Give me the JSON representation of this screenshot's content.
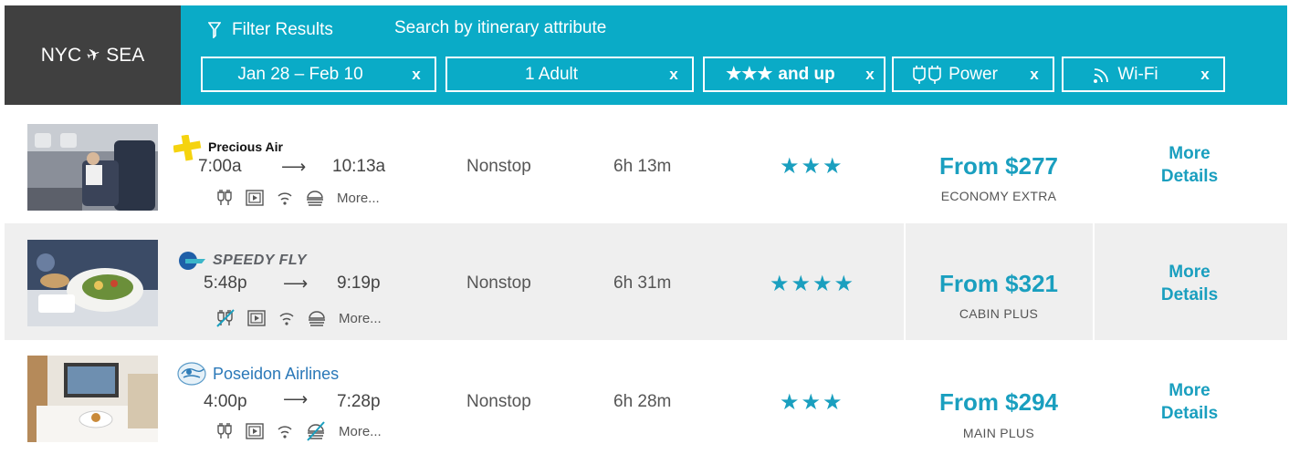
{
  "route": {
    "origin": "NYC",
    "destination": "SEA"
  },
  "filter": {
    "title": "Filter Results",
    "subtitle": "Search by itinerary attribute",
    "chips": [
      {
        "label": "Jan 28 – Feb 10",
        "close": "x"
      },
      {
        "label": "1 Adult",
        "close": "x"
      },
      {
        "stars": "★★★",
        "label": "and up",
        "close": "x"
      },
      {
        "label": "Power",
        "close": "x",
        "icon": "power-plug-icon"
      },
      {
        "label": "Wi-Fi",
        "close": "x",
        "icon": "wifi-icon"
      }
    ]
  },
  "flights": [
    {
      "airline": "Precious Air",
      "logo_icon": "precious-air-logo",
      "depart": "7:00a",
      "arrow": "⟶",
      "arrive": "10:13a",
      "amenities": [
        "power-icon",
        "entertainment-icon",
        "wifi-icon",
        "meal-icon"
      ],
      "more": "More...",
      "stops": "Nonstop",
      "duration": "6h 13m",
      "rating": "★★★",
      "price": "From $277",
      "fare": "ECONOMY EXTRA",
      "details": [
        "More",
        "Details"
      ]
    },
    {
      "airline": "SPEEDY FLY",
      "logo_icon": "speedy-fly-logo",
      "depart": "5:48p",
      "arrow": "⟶",
      "arrive": "9:19p",
      "amenities": [
        "power-unavailable-icon",
        "entertainment-icon",
        "wifi-icon",
        "meal-icon"
      ],
      "more": "More...",
      "stops": "Nonstop",
      "duration": "6h 31m",
      "rating": "★★★★",
      "price": "From $321",
      "fare": "CABIN PLUS",
      "details": [
        "More",
        "Details"
      ]
    },
    {
      "airline": "Poseidon Airlines",
      "logo_icon": "poseidon-airlines-logo",
      "depart": "4:00p",
      "arrow": "⟶",
      "arrive": "7:28p",
      "amenities": [
        "power-icon",
        "entertainment-icon",
        "wifi-icon",
        "meal-unavailable-icon"
      ],
      "more": "More...",
      "stops": "Nonstop",
      "duration": "6h 28m",
      "rating": "★★★",
      "price": "From $294",
      "fare": "MAIN PLUS",
      "details": [
        "More",
        "Details"
      ]
    }
  ],
  "colors": {
    "accent": "#0aabc7",
    "route_bg": "#404040",
    "alt_row": "#efefef",
    "link": "#1a9fbf"
  }
}
